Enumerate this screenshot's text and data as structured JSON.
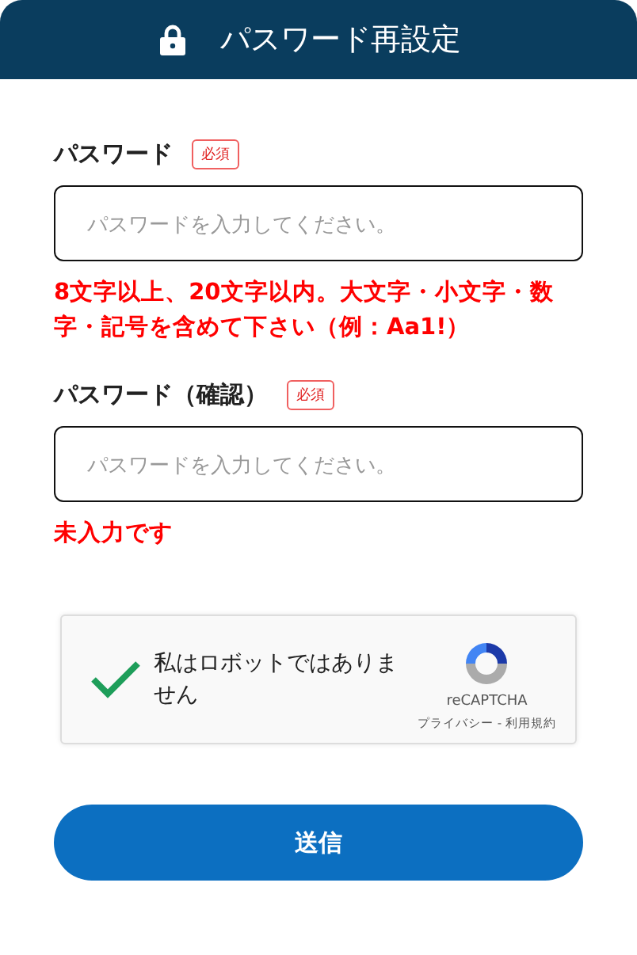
{
  "header": {
    "title": "パスワード再設定"
  },
  "fields": [
    {
      "label": "パスワード",
      "required_badge": "必須",
      "placeholder": "パスワードを入力してください。",
      "error": "8文字以上、20文字以内。大文字・小文字・数字・記号を含めて下さい（例：Aa1!）"
    },
    {
      "label": "パスワード（確認）",
      "required_badge": "必須",
      "placeholder": "パスワードを入力してください。",
      "error": "未入力です"
    }
  ],
  "captcha": {
    "label": "私はロボットではありません",
    "checked": true,
    "brand": "reCAPTCHA",
    "links": "プライバシー - 利用規約"
  },
  "submit_button": "送信"
}
